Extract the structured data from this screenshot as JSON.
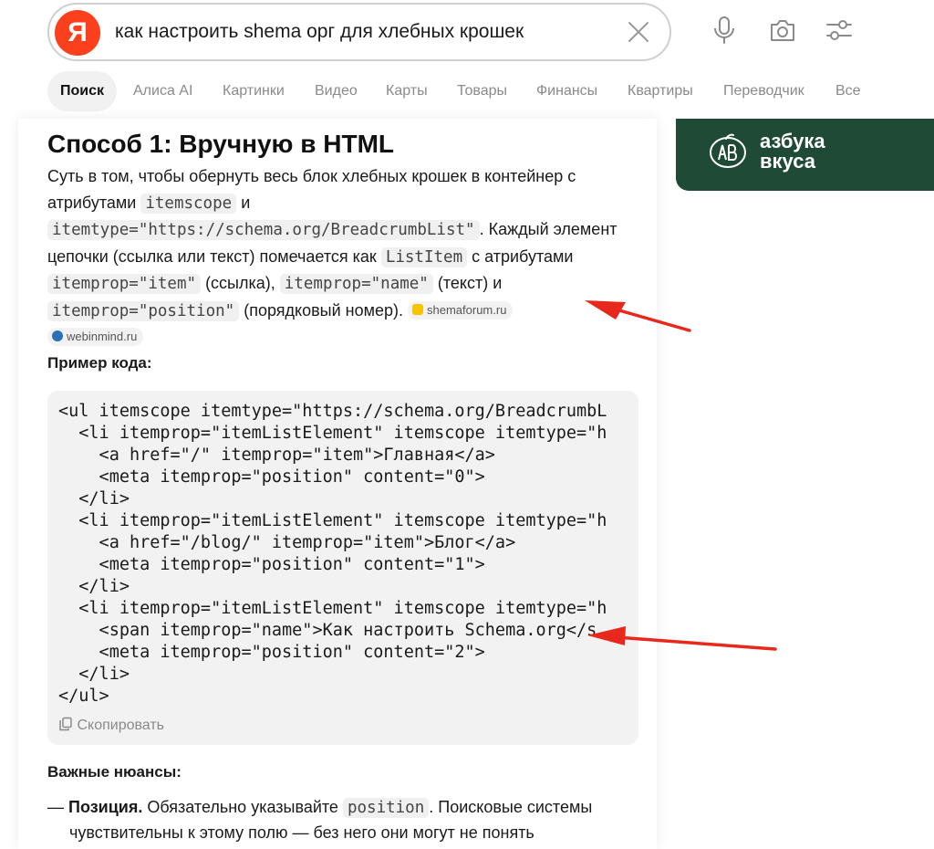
{
  "search": {
    "logo_letter": "Я",
    "query": "как настроить shema орг для хлебных крошек"
  },
  "header_icons": [
    "close-icon",
    "microphone-icon",
    "camera-icon",
    "filter-settings-icon"
  ],
  "tabs": [
    "Поиск",
    "Алиса AI",
    "Картинки",
    "Видео",
    "Карты",
    "Товары",
    "Финансы",
    "Квартиры",
    "Переводчик",
    "Все"
  ],
  "answer": {
    "title": "Способ 1: Вручную в HTML",
    "p_1": "Суть в том, чтобы обернуть весь блок хлебных крошек в контейнер с атрибутами",
    "code_itemscope": "itemscope",
    "p_2": "и",
    "code_itemtype": "itemtype=\"https://schema.org/BreadcrumbList\"",
    "p_3": ". Каждый элемент цепочки (ссылка или текст) помечается как",
    "code_listitem": "ListItem",
    "p_4": "с атрибутами",
    "code_itemprop_item": "itemprop=\"item\"",
    "p_5": "(ссылка),",
    "code_itemprop_name": "itemprop=\"name\"",
    "p_6": "(текст) и",
    "code_itemprop_position": "itemprop=\"position\"",
    "p_7": "(порядковый номер).",
    "source_1": "shemaforum.ru",
    "source_2": "webinmind.ru",
    "code_example_heading": "Пример кода:",
    "code_lines": [
      "<ul itemscope itemtype=\"https://schema.org/BreadcrumbL",
      "  <li itemprop=\"itemListElement\" itemscope itemtype=\"h",
      "    <a href=\"/\" itemprop=\"item\">Главная</a>",
      "    <meta itemprop=\"position\" content=\"0\">",
      "  </li>",
      "  <li itemprop=\"itemListElement\" itemscope itemtype=\"h",
      "    <a href=\"/blog/\" itemprop=\"item\">Блог</a>",
      "    <meta itemprop=\"position\" content=\"1\">",
      "  </li>",
      "  <li itemprop=\"itemListElement\" itemscope itemtype=\"h",
      "    <span itemprop=\"name\">Как настроить Schema.org</s",
      "    <meta itemprop=\"position\" content=\"2\">",
      "  </li>",
      "</ul>"
    ],
    "copy_label": "Скопировать",
    "nuances_heading": "Важные нюансы:",
    "bullet_dash": "—",
    "bullet_bold": "Позиция.",
    "bullet_text_1": "Обязательно указывайте",
    "bullet_code": "position",
    "bullet_text_2": ". Поисковые системы",
    "bullet_cont": "чувствительны к этому полю — без него они могут не понять"
  },
  "ad": {
    "line_1": "азбука",
    "line_2": "вкуса",
    "bg_color": "#1f4a36"
  },
  "colors": {
    "brand": "#fc3f1d",
    "arrow": "#e8281c"
  }
}
